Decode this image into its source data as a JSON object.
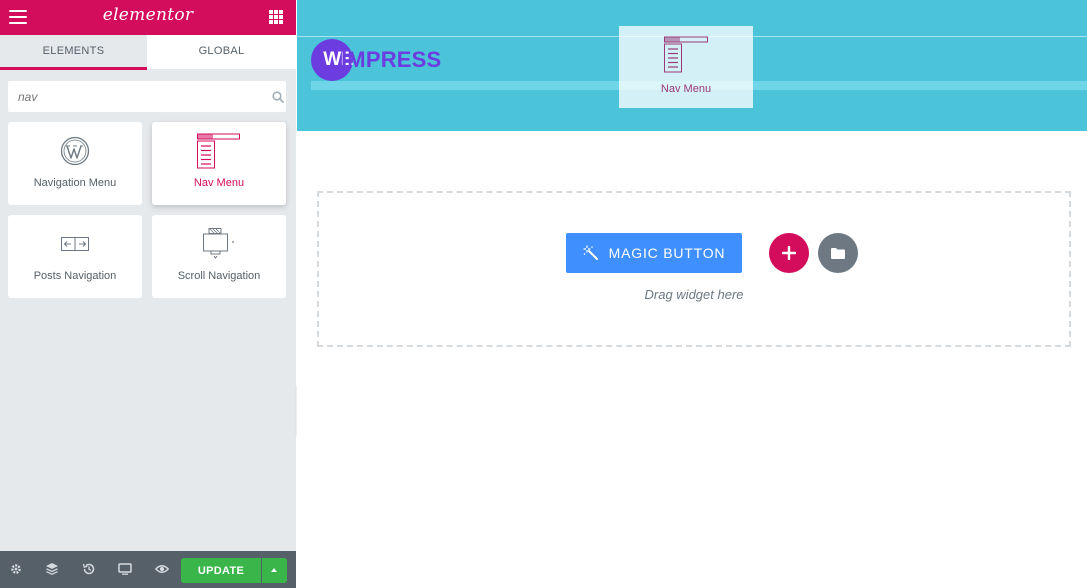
{
  "panel": {
    "brand": "elementor",
    "tabs": [
      {
        "label": "ELEMENTS",
        "active": true
      },
      {
        "label": "GLOBAL",
        "active": false
      }
    ],
    "search": {
      "value": "",
      "placeholder": "nav"
    },
    "widgets": [
      {
        "label": "Navigation Menu",
        "icon": "wordpress-icon",
        "active": false
      },
      {
        "label": "Nav Menu",
        "icon": "nav-menu-icon",
        "active": true
      },
      {
        "label": "Posts Navigation",
        "icon": "posts-navigation-icon",
        "active": false
      },
      {
        "label": "Scroll Navigation",
        "icon": "scroll-navigation-icon",
        "active": false
      }
    ],
    "footer": {
      "icons": [
        "settings-icon",
        "layers-icon",
        "history-icon",
        "responsive-desktop-icon",
        "preview-eye-icon"
      ],
      "update_label": "UPDATE"
    }
  },
  "canvas": {
    "logo": {
      "part1": "WE",
      "part2": "IMPRESS"
    },
    "drag_ghost_label": "Nav Menu",
    "magic_button_label": "MAGIC BUTTON",
    "drag_hint": "Drag widget here"
  },
  "colors": {
    "brand": "#d30c5c",
    "panel_bg": "#e6e9ec",
    "footer_bg": "#556068",
    "update_green": "#39b54a",
    "hero_bg": "#4bc3d8",
    "logo_purple": "#6c3ce0",
    "magic_blue": "#3f8fff",
    "template_gray": "#6d7882"
  }
}
